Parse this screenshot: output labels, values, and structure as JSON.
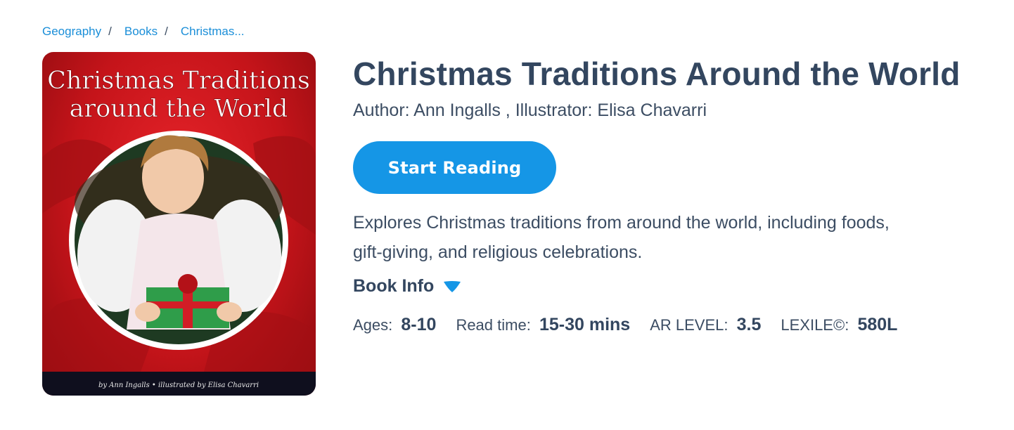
{
  "breadcrumb": {
    "items": [
      "Geography",
      "Books",
      "Christmas..."
    ],
    "separator": "/"
  },
  "cover": {
    "title_line1": "Christmas Traditions",
    "title_line2": "around the World",
    "byline": "by Ann Ingalls • illustrated by Elisa Chavarri"
  },
  "book": {
    "title": "Christmas Traditions Around the World",
    "credits": "Author: Ann Ingalls , Illustrator: Elisa Chavarri",
    "start_label": "Start Reading",
    "description": "Explores Christmas traditions from around the world, including foods, gift-giving, and religious celebrations.",
    "info_label": "Book Info",
    "info_icon": "caret-down-icon"
  },
  "meta": {
    "ages_label": "Ages:",
    "ages_value": "8-10",
    "read_label": "Read time:",
    "read_value": "15-30 mins",
    "ar_label": "AR LEVEL:",
    "ar_value": "3.5",
    "lexile_label": "LEXILE©:",
    "lexile_value": "580L"
  },
  "colors": {
    "accent": "#1596e6",
    "link": "#1a8ed8",
    "text": "#3c4d63",
    "cover_red": "#d01a20"
  }
}
